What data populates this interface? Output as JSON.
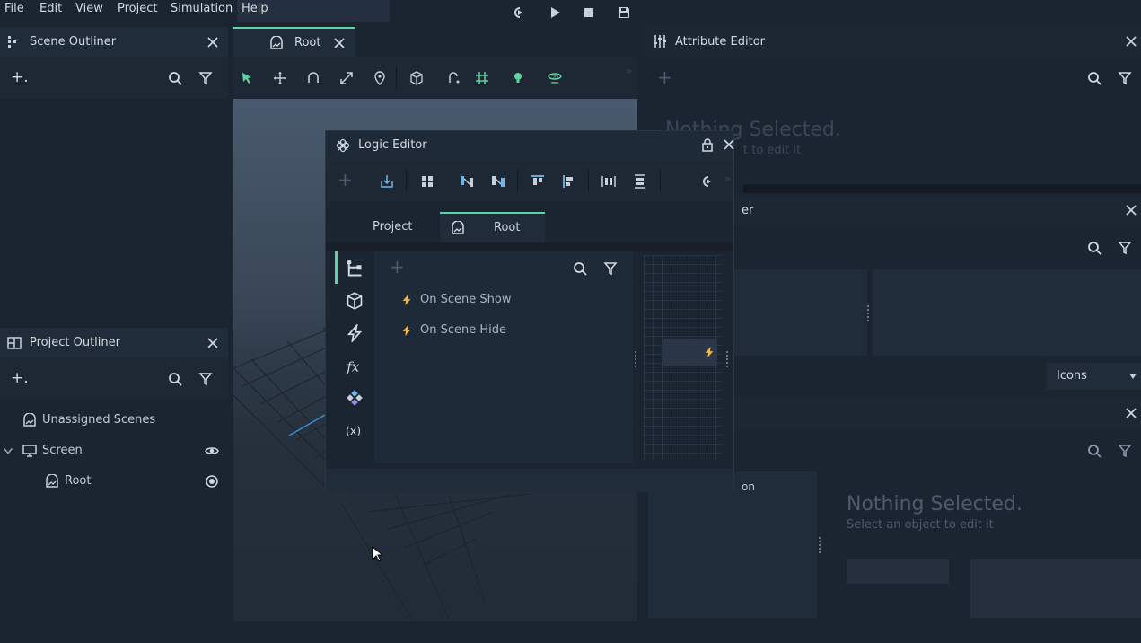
{
  "menu": [
    "File",
    "Edit",
    "View",
    "Project",
    "Simulation",
    "Help"
  ],
  "scene_outliner": {
    "title": "Scene Outliner",
    "add": "+."
  },
  "project_outliner": {
    "title": "Project Outliner",
    "add": "+.",
    "items": [
      {
        "label": "Unassigned Scenes",
        "icon": "scene-icon"
      },
      {
        "label": "Screen",
        "icon": "monitor-icon"
      },
      {
        "label": "Root",
        "icon": "scene-icon"
      }
    ]
  },
  "viewport_tab": {
    "label": "Root"
  },
  "attribute_editor": {
    "title": "Attribute Editor",
    "nothing_title": "Nothing Selected.",
    "nothing_sub": "Select an object to edit it",
    "nothing_sub_clipped": "t to edit it"
  },
  "hidden_panel": {
    "title_fragment": "er",
    "dropdown": "Icons",
    "fragment2": "on"
  },
  "lower_panel": {
    "nothing_title": "Nothing Selected.",
    "nothing_sub": "Select an object to edit it"
  },
  "logic_editor": {
    "title": "Logic Editor",
    "tabs": [
      "Project",
      "Root"
    ],
    "events": [
      "On Scene Show",
      "On Scene Hide"
    ]
  },
  "colors": {
    "accent": "#5fd3a2",
    "bolt": "#f0b93a",
    "panel": "#212c3a",
    "bg": "#1b2532"
  }
}
